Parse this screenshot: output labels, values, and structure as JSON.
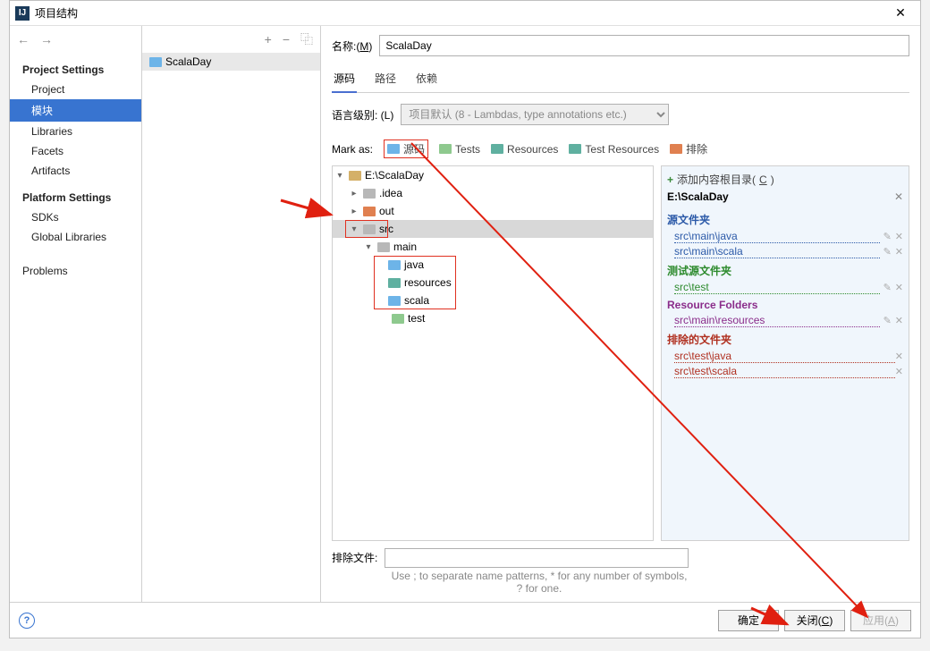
{
  "window": {
    "title": "项目结构",
    "close": "✕"
  },
  "leftnav": {
    "back": "←",
    "fwd": "→",
    "project_settings": "Project Settings",
    "items_ps": [
      "Project",
      "模块",
      "Libraries",
      "Facets",
      "Artifacts"
    ],
    "platform_settings": "Platform Settings",
    "items_plat": [
      "SDKs",
      "Global Libraries"
    ],
    "problems": "Problems"
  },
  "midtoolbar": {
    "add": "+",
    "remove": "−",
    "copy": "⿻"
  },
  "midlist": {
    "item0": "ScalaDay"
  },
  "name": {
    "label_pre": "名称:(",
    "label_m": "M",
    "label_post": ")",
    "value": "ScalaDay"
  },
  "tabs": {
    "sources": "源码",
    "paths": "路径",
    "deps": "依赖"
  },
  "lang": {
    "label_pre": "语言级别:  (",
    "label_l": "L",
    "label_post": ")",
    "option": "项目默认 (8 - Lambdas, type annotations etc.)"
  },
  "mark": {
    "label": "Mark as:",
    "sources": "源码",
    "tests": "Tests",
    "resources": "Resources",
    "test_resources": "Test Resources",
    "excluded": "排除"
  },
  "tree": {
    "root": "E:\\ScalaDay",
    "idea": ".idea",
    "out": "out",
    "src": "src",
    "main": "main",
    "java": "java",
    "resources": "resources",
    "scala": "scala",
    "test": "test"
  },
  "rp": {
    "add_root_pre": "添加内容根目录(",
    "add_root_c": "C",
    "add_root_post": ")",
    "root": "E:\\ScalaDay",
    "src_folders": "源文件夹",
    "src_items": [
      "src\\main\\java",
      "src\\main\\scala"
    ],
    "test_src_folders": "测试源文件夹",
    "test_items": [
      "src\\test"
    ],
    "resource_folders": "Resource Folders",
    "res_items": [
      "src\\main\\resources"
    ],
    "excl_folders": "排除的文件夹",
    "excl_items": [
      "src\\test\\java",
      "src\\test\\scala"
    ]
  },
  "exclude": {
    "label": "排除文件:",
    "hint": "Use ; to separate name patterns, * for any number of symbols, ? for one."
  },
  "footer": {
    "ok": "确定",
    "close_pre": "关闭(",
    "close_c": "C",
    "close_post": ")",
    "apply_pre": "应用(",
    "apply_a": "A",
    "apply_post": ")"
  }
}
